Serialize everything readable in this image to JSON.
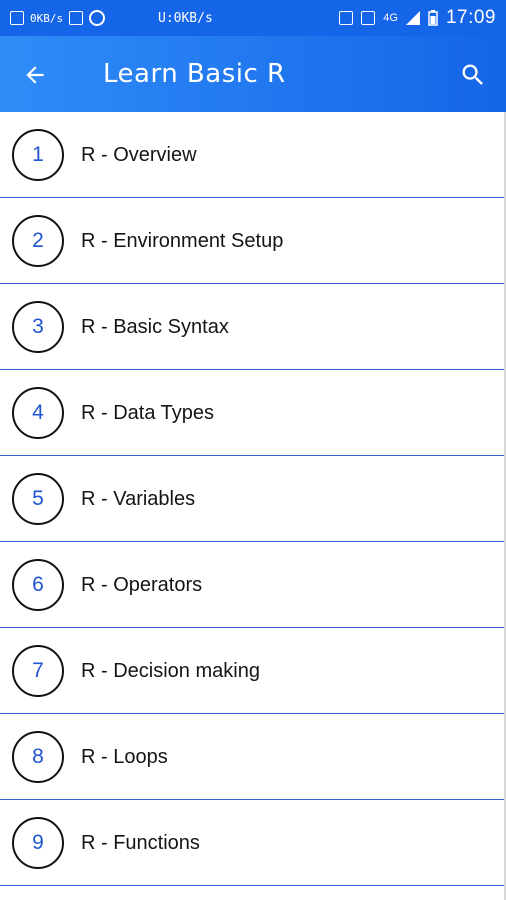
{
  "status_bar": {
    "left_text": "0KB/s",
    "center_text": "U:0KB/s",
    "network": "4G",
    "time": "17:09"
  },
  "app_bar": {
    "title": "Learn Basic R",
    "back_icon": "arrow-left-icon",
    "search_icon": "search-icon"
  },
  "colors": {
    "primary": "#1565e8",
    "primary_light": "#2f8cf7",
    "number_color": "#1f55d0",
    "divider": "#3b62d4"
  },
  "items": [
    {
      "number": "1",
      "label": "R - Overview"
    },
    {
      "number": "2",
      "label": "R - Environment Setup"
    },
    {
      "number": "3",
      "label": "R - Basic Syntax"
    },
    {
      "number": "4",
      "label": "R - Data Types"
    },
    {
      "number": "5",
      "label": "R - Variables"
    },
    {
      "number": "6",
      "label": "R - Operators"
    },
    {
      "number": "7",
      "label": "R - Decision making"
    },
    {
      "number": "8",
      "label": "R - Loops"
    },
    {
      "number": "9",
      "label": "R - Functions"
    }
  ]
}
